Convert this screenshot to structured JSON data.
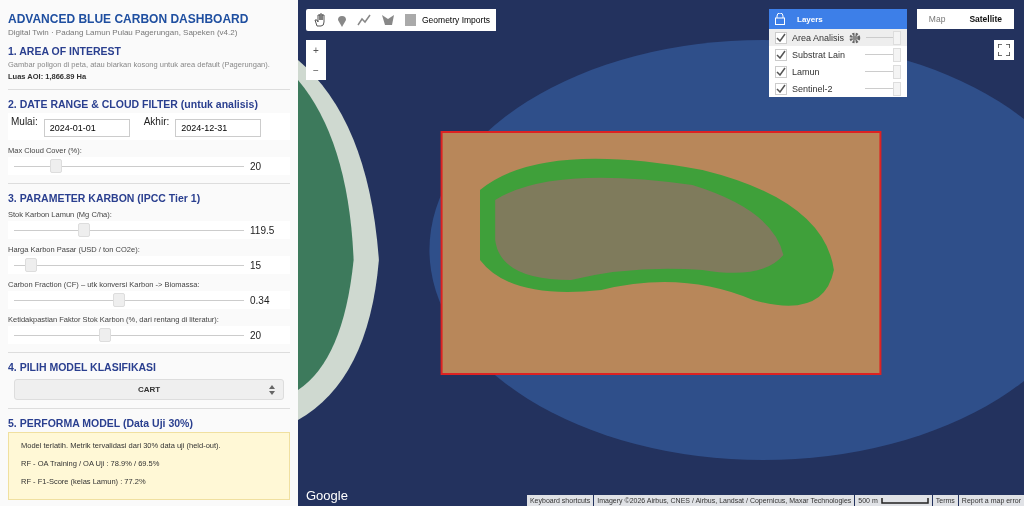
{
  "sidebar": {
    "title": "ADVANCED BLUE CARBON DASHBOARD",
    "subtitle": "Digital Twin · Padang Lamun Pulau Pagerungan, Sapeken (v4.2)",
    "aoi": {
      "heading": "1. AREA OF INTEREST",
      "hint": "Gambar poligon di peta, atau biarkan kosong untuk area default (Pagerungan).",
      "area": "Luas AOI: 1,866.89 Ha"
    },
    "date": {
      "heading": "2. DATE RANGE & CLOUD FILTER (untuk analisis)",
      "start_label": "Mulai:",
      "start": "2024-01-01",
      "end_label": "Akhir:",
      "end": "2024-12-31",
      "cloud": {
        "label": "Max Cloud Cover (%):",
        "level": 0.18,
        "reading": "20"
      }
    },
    "carbon": {
      "heading": "3. PARAMETER KARBON (IPCC Tier 1)",
      "sliders": [
        {
          "label": "Stok Karbon Lamun (Mg C/ha):",
          "level": 0.3,
          "reading": "119.5"
        },
        {
          "label": "Harga Karbon Pasar (USD / ton CO2e):",
          "level": 0.07,
          "reading": "15"
        },
        {
          "label": "Carbon Fraction (CF) – utk konversi Karbon -> Biomassa:",
          "level": 0.45,
          "reading": "0.34"
        },
        {
          "label": "Ketidakpastian Faktor Stok Karbon (%, dari rentang di literatur):",
          "level": 0.39,
          "reading": "20"
        }
      ]
    },
    "model": {
      "heading": "4. PILIH MODEL KLASIFIKASI",
      "value": "CART"
    },
    "performance": {
      "heading": "5. PERFORMA MODEL (Data Uji 30%)",
      "lines": [
        "Model terlatih. Metrik tervalidasi dari 30% data uji (held-out).",
        "RF - OA Training / OA Uji : 78.9% / 69.5%",
        "RF - F1-Score (kelas Lamun) : 77.2%"
      ]
    }
  },
  "map": {
    "geometry_imports": "Geometry Imports",
    "zoom_in": "+",
    "zoom_out": "−",
    "layers": {
      "title": "Layers",
      "items": [
        {
          "name": "Area Analisis",
          "checked": true,
          "level": 1,
          "settings": true
        },
        {
          "name": "Substrat Lain",
          "checked": true,
          "level": 1,
          "settings": false
        },
        {
          "name": "Lamun",
          "checked": true,
          "level": 1,
          "settings": false
        },
        {
          "name": "Sentinel-2",
          "checked": true,
          "level": 1,
          "settings": false
        }
      ]
    },
    "map_types": [
      {
        "label": "Map",
        "selected": false
      },
      {
        "label": "Satellite",
        "selected": true
      }
    ],
    "logo": "Google",
    "footer": [
      "Keyboard shortcuts",
      "Imagery ©2026 Airbus, CNES / Airbus, Landsat / Copernicus, Maxar Technologies",
      "500 m",
      "Terms",
      "Report a map error"
    ]
  }
}
